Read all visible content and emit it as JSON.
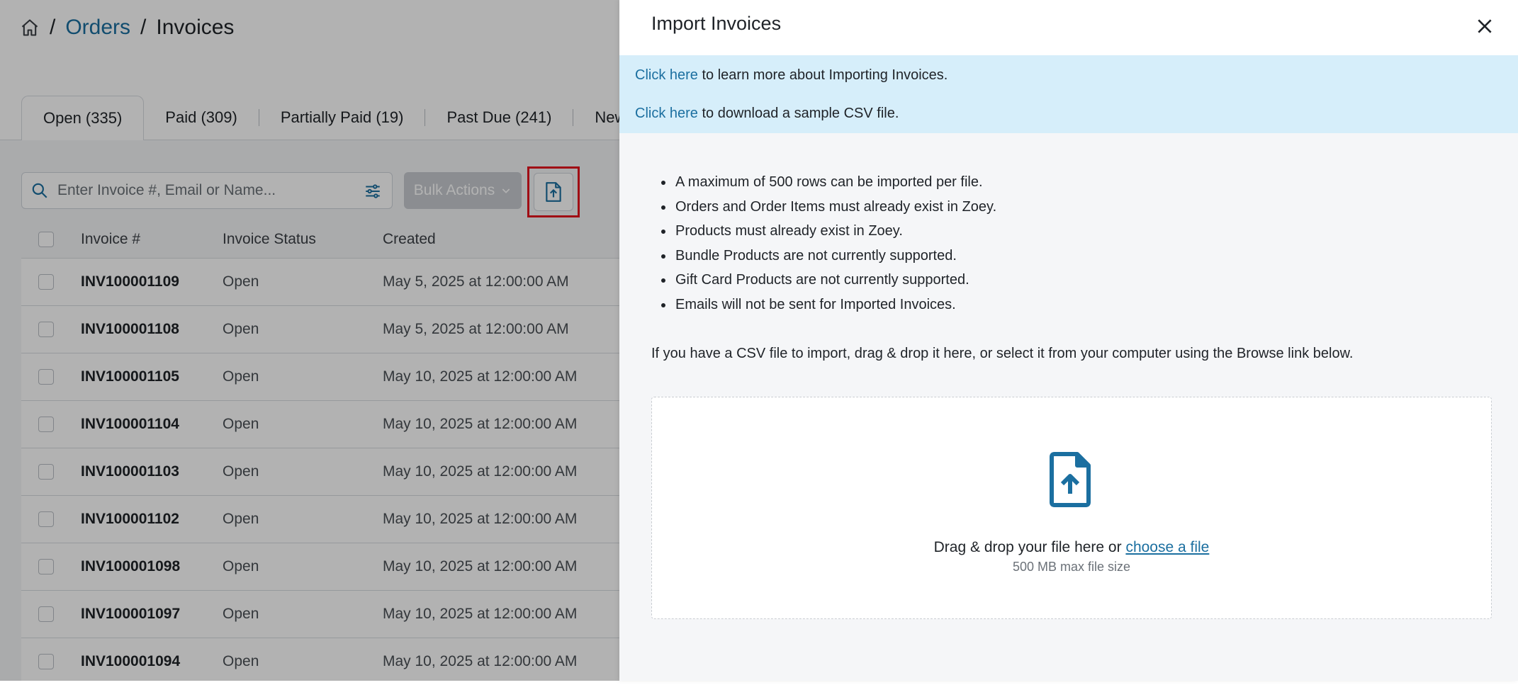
{
  "breadcrumb": {
    "home_icon": "home-icon",
    "separator": "/",
    "orders": "Orders",
    "invoices": "Invoices"
  },
  "tabs": [
    {
      "label": "Open (335)",
      "active": true
    },
    {
      "label": "Paid (309)"
    },
    {
      "label": "Partially Paid (19)"
    },
    {
      "label": "Past Due (241)"
    },
    {
      "label": "New"
    }
  ],
  "toolbar": {
    "search_placeholder": "Enter Invoice #, Email or Name...",
    "bulk_actions": "Bulk Actions",
    "bulk_chevron": "⌄"
  },
  "table": {
    "columns": [
      "Invoice #",
      "Invoice Status",
      "Created"
    ],
    "rows": [
      {
        "invoice": "INV100001109",
        "status": "Open",
        "created": "May 5, 2025 at 12:00:00 AM"
      },
      {
        "invoice": "INV100001108",
        "status": "Open",
        "created": "May 5, 2025 at 12:00:00 AM"
      },
      {
        "invoice": "INV100001105",
        "status": "Open",
        "created": "May 10, 2025 at 12:00:00 AM"
      },
      {
        "invoice": "INV100001104",
        "status": "Open",
        "created": "May 10, 2025 at 12:00:00 AM"
      },
      {
        "invoice": "INV100001103",
        "status": "Open",
        "created": "May 10, 2025 at 12:00:00 AM"
      },
      {
        "invoice": "INV100001102",
        "status": "Open",
        "created": "May 10, 2025 at 12:00:00 AM"
      },
      {
        "invoice": "INV100001098",
        "status": "Open",
        "created": "May 10, 2025 at 12:00:00 AM"
      },
      {
        "invoice": "INV100001097",
        "status": "Open",
        "created": "May 10, 2025 at 12:00:00 AM"
      },
      {
        "invoice": "INV100001094",
        "status": "Open",
        "created": "May 10, 2025 at 12:00:00 AM"
      }
    ]
  },
  "panel": {
    "title": "Import Invoices",
    "close_label": "×",
    "info": {
      "line1_link": "Click here",
      "line1_text": " to learn more about Importing Invoices.",
      "line2_link": "Click here",
      "line2_text": " to download a sample CSV file."
    },
    "rules": [
      "A maximum of 500 rows can be imported per file.",
      "Orders and Order Items must already exist in Zoey.",
      "Products must already exist in Zoey.",
      "Bundle Products are not currently supported.",
      "Gift Card Products are not currently supported.",
      "Emails will not be sent for Imported Invoices."
    ],
    "instruction": "If you have a CSV file to import, drag & drop it here, or select it from your computer using the Browse link below.",
    "dropzone": {
      "text": "Drag & drop your file here or ",
      "link": "choose a file",
      "sub": "500 MB max file size"
    }
  },
  "colors": {
    "link": "#1b6fa0",
    "highlight": "#e5121d",
    "info_bg": "#d6eefa",
    "overlay": "rgba(0,0,0,0.30)"
  }
}
